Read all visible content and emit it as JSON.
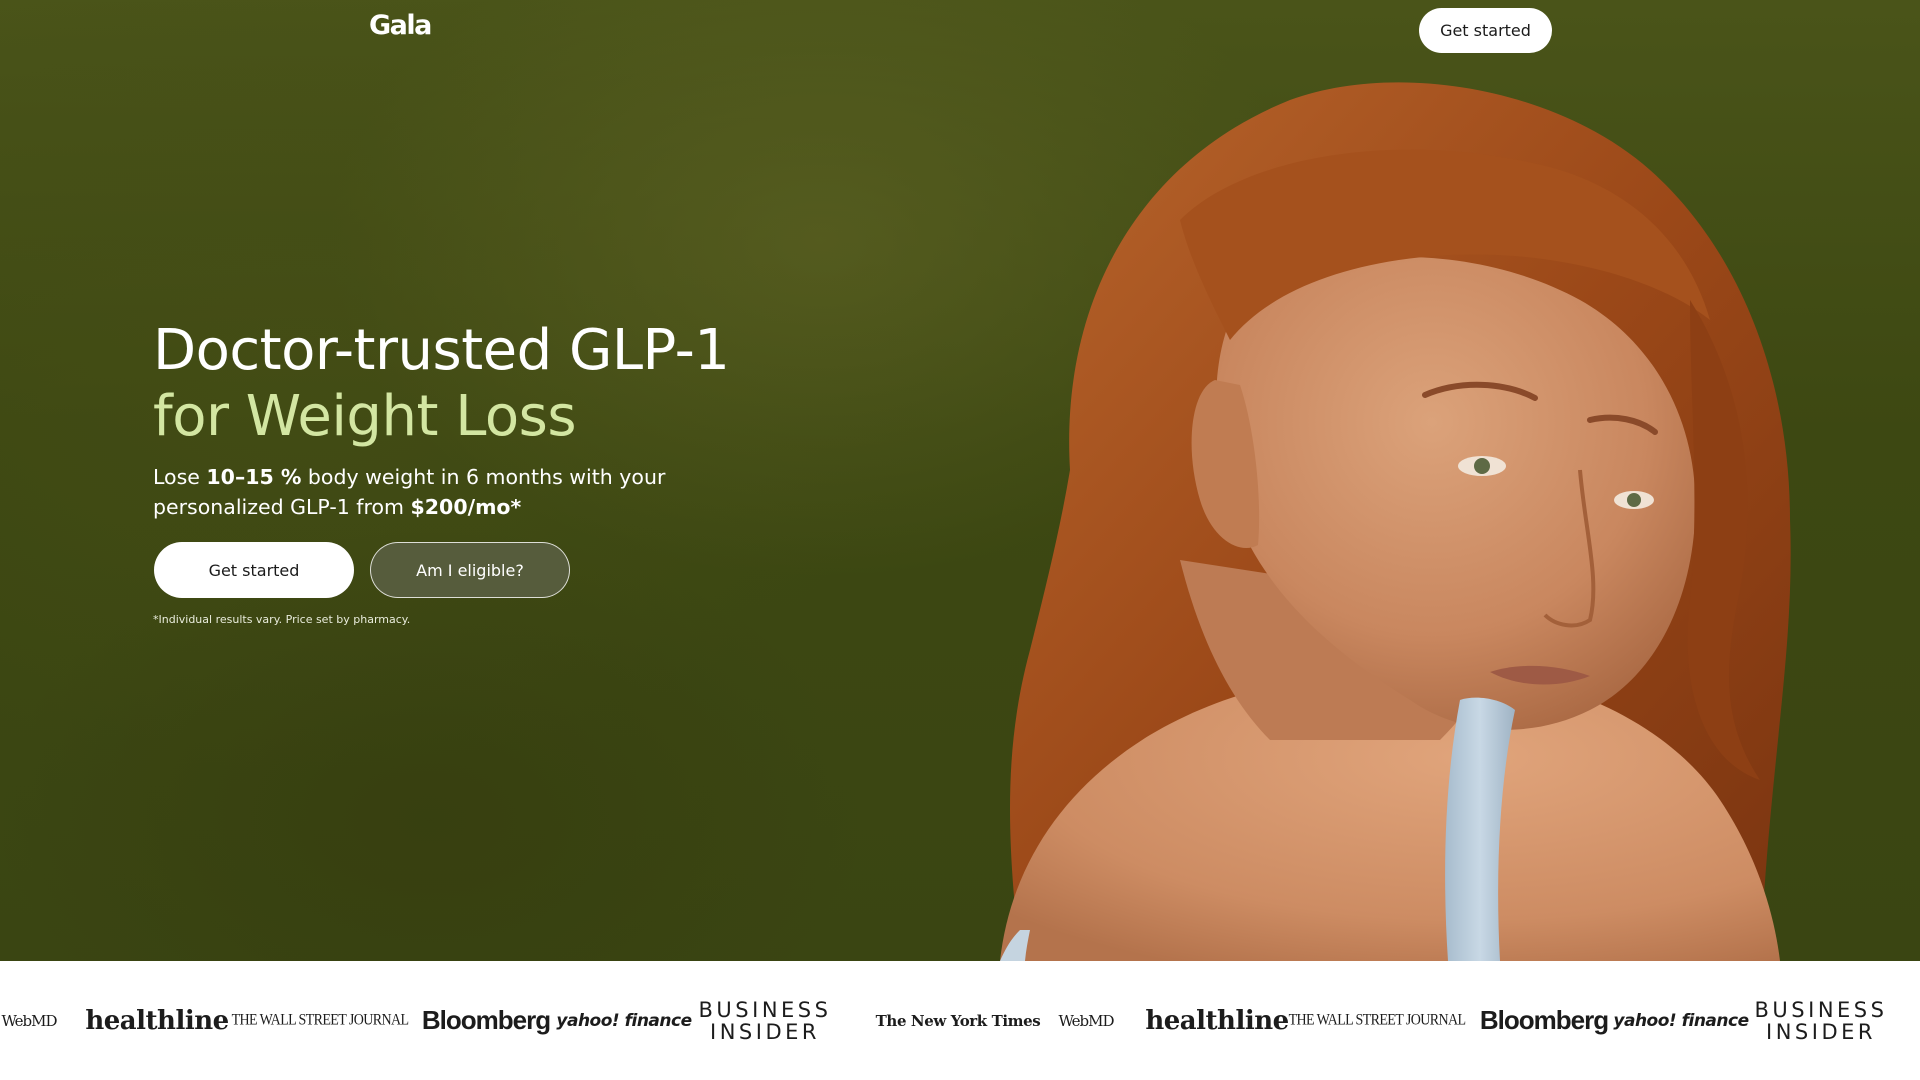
{
  "brand": {
    "logo_text": "Gala"
  },
  "nav": {
    "cta_label": "Get started"
  },
  "hero": {
    "headline_line1": "Doctor-trusted GLP-1",
    "headline_line2": "for Weight Loss",
    "subtitle_part1": "Lose ",
    "subtitle_bold1": "10–15 %",
    "subtitle_part2": " body weight in 6 months with your personalized GLP-1 from ",
    "subtitle_bold2": "$200/mo*",
    "primary_cta": "Get started",
    "secondary_cta": "Am I eligible?",
    "disclaimer": "*Individual results vary. Price set by pharmacy.",
    "image_alt": "Woman with red hair looking over her shoulder"
  },
  "press": {
    "logos": [
      "WebMD",
      "healthline",
      "THE WALL STREET JOURNAL",
      "Bloomberg",
      "yahoo! finance",
      "BUSINESS INSIDER",
      "The New York Times",
      "WebMD",
      "healthline",
      "THE WALL STREET JOURNAL",
      "Bloomberg",
      "yahoo! finance",
      "BUSINESS INSIDER"
    ]
  },
  "colors": {
    "hero_background": "#3d4812",
    "headline_accent": "#d3e6a2",
    "hair": "#a9521f",
    "skin": "#cf916a",
    "strap": "#b9cbda"
  }
}
